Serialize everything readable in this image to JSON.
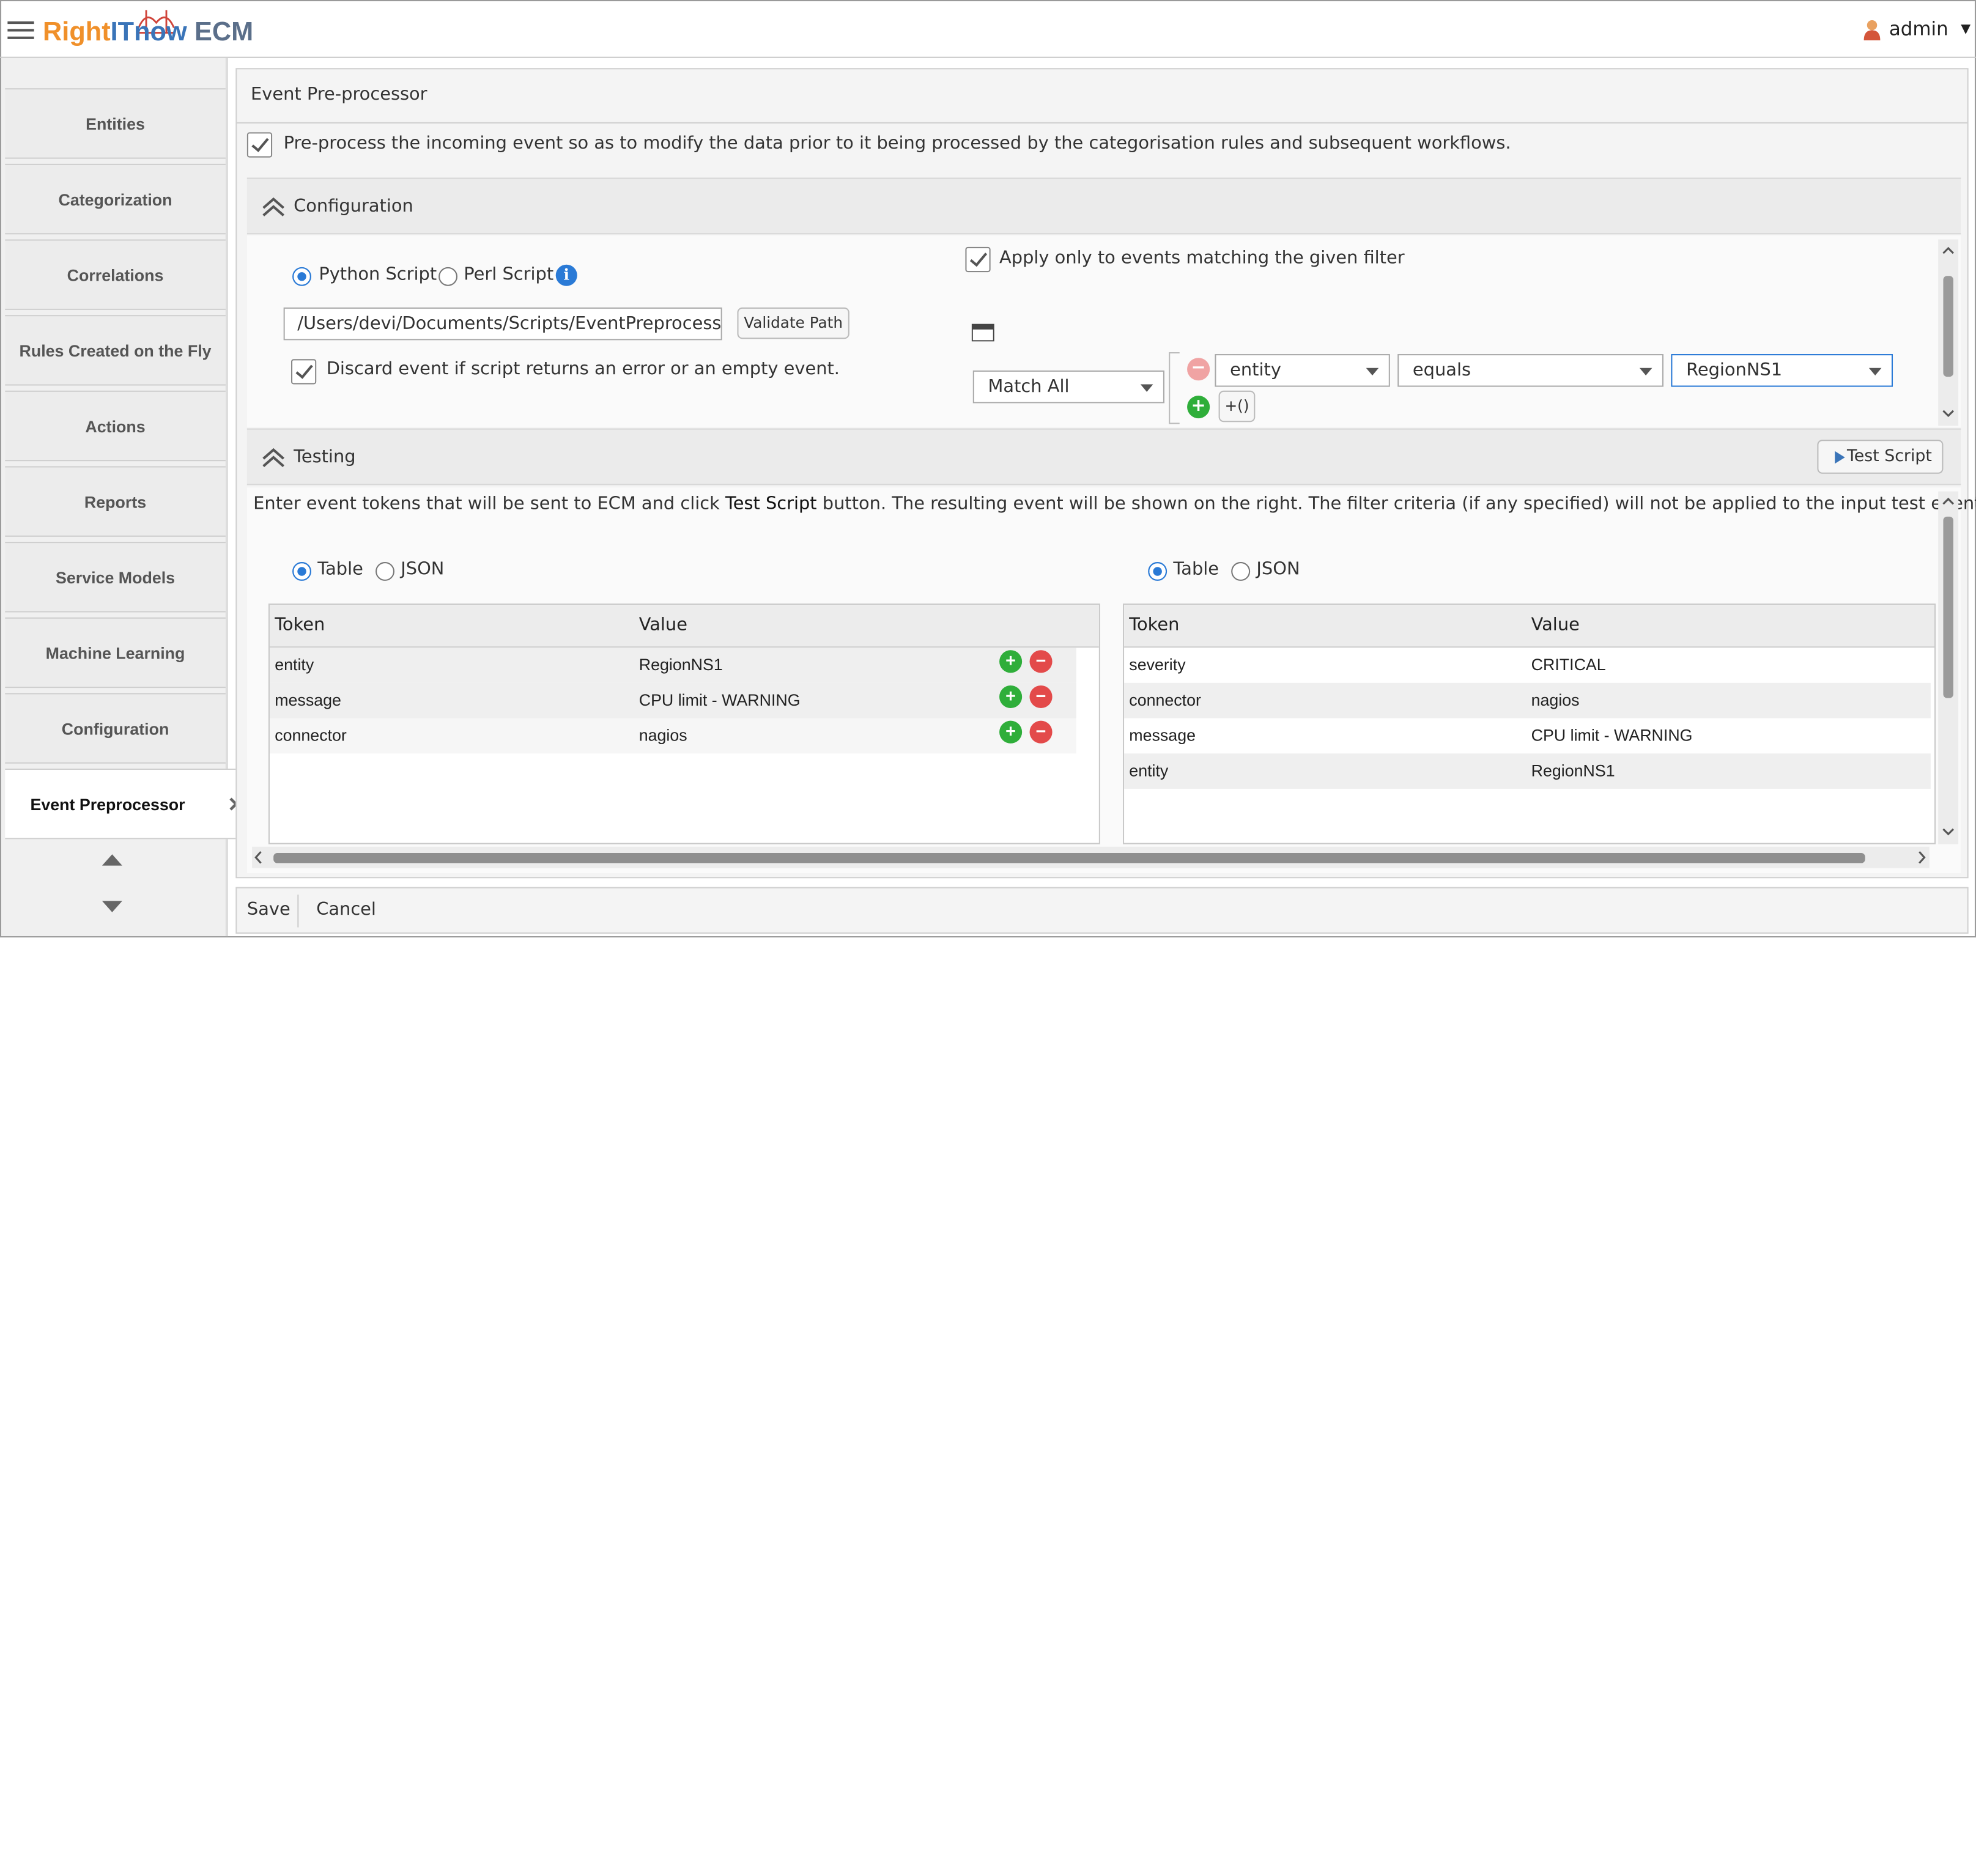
{
  "app": {
    "logo_part1": "Right",
    "logo_part2": "IT",
    "logo_part3": "now",
    "logo_part4": "ECM",
    "user": "admin"
  },
  "sidebar": {
    "items": [
      {
        "label": "Entities"
      },
      {
        "label": "Categorization"
      },
      {
        "label": "Correlations"
      },
      {
        "label": "Rules Created on the Fly"
      },
      {
        "label": "Actions"
      },
      {
        "label": "Reports"
      },
      {
        "label": "Service Models"
      },
      {
        "label": "Machine Learning"
      },
      {
        "label": "Configuration"
      },
      {
        "label": "Event Preprocessor"
      }
    ]
  },
  "page": {
    "title": "Event Pre-processor",
    "preprocess_label": "Pre-process the incoming event so as to modify the data prior to it being processed by the categorisation rules and subsequent workflows."
  },
  "configuration": {
    "title": "Configuration",
    "python_label": "Python Script",
    "perl_label": "Perl Script",
    "path_value": "/Users/devi/Documents/Scripts/EventPreprocessor",
    "validate_label": "Validate Path",
    "discard_label": "Discard event if script returns an error or an empty event.",
    "apply_filter_label": "Apply only to events matching the given filter",
    "match_value": "Match All",
    "filter": {
      "field": "entity",
      "operator": "equals",
      "value": "RegionNS1",
      "group_label": "+()"
    }
  },
  "testing": {
    "title": "Testing",
    "test_button": "Test Script",
    "instruction_pre": "Enter event tokens that will be sent to ECM and click ",
    "instruction_btn": "Test Script",
    "instruction_post": " button. The resulting event will be shown on the right. The filter criteria (if any specified) will not be applied to the input test event data.",
    "left": {
      "table_label": "Table",
      "json_label": "JSON",
      "col_token": "Token",
      "col_value": "Value",
      "rows": [
        {
          "token": "entity",
          "value": "RegionNS1"
        },
        {
          "token": "message",
          "value": "CPU limit - WARNING"
        },
        {
          "token": "connector",
          "value": "nagios"
        }
      ]
    },
    "right": {
      "table_label": "Table",
      "json_label": "JSON",
      "col_token": "Token",
      "col_value": "Value",
      "rows": [
        {
          "token": "severity",
          "value": "CRITICAL"
        },
        {
          "token": "connector",
          "value": "nagios"
        },
        {
          "token": "message",
          "value": "CPU limit - WARNING"
        },
        {
          "token": "entity",
          "value": "RegionNS1"
        }
      ]
    }
  },
  "footer": {
    "save": "Save",
    "cancel": "Cancel"
  },
  "colors": {
    "accent": "#2a7ad6",
    "logo_orange": "#f0902a",
    "logo_blue": "#3a74b8",
    "add_green": "#2fae3a",
    "remove_red": "#e34a4a"
  }
}
